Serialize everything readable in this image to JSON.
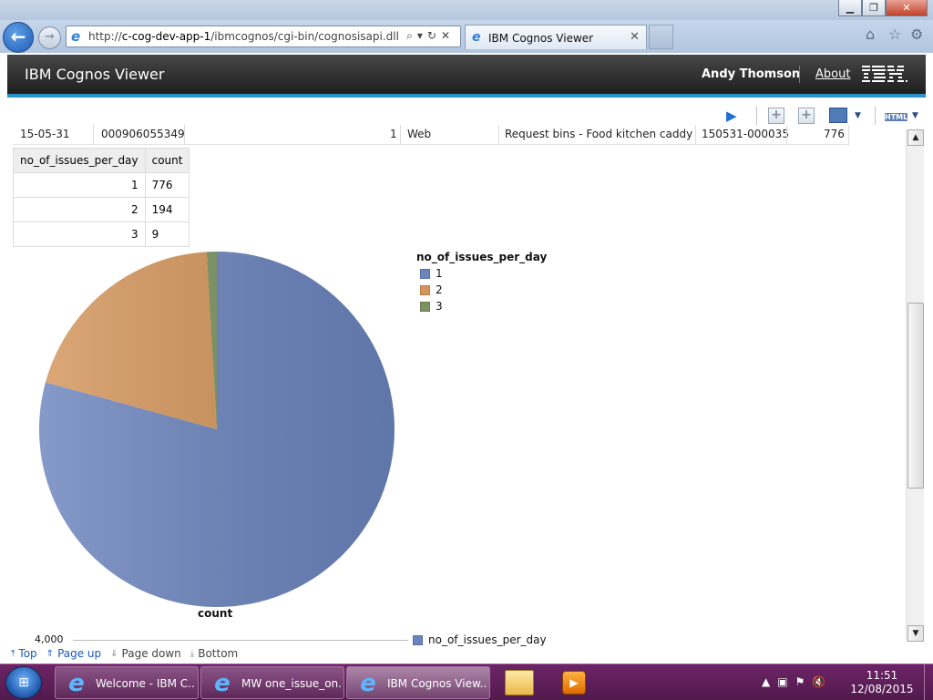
{
  "browser": {
    "url_prefix": "http://",
    "url_host": "c-cog-dev-app-1",
    "url_path": "/ibmcognos/cgi-bin/cognosisapi.dll",
    "tab_title": "IBM Cognos Viewer"
  },
  "header": {
    "app_title": "IBM Cognos Viewer",
    "user_name": "Andy Thomson",
    "about_link": "About",
    "logo": "IBM."
  },
  "list_row": {
    "date": "15-05-31",
    "id": "000906055349",
    "count": "1",
    "channel": "Web",
    "request": "Request bins - Food kitchen caddy",
    "case_ref": "150531-000035",
    "total": "776"
  },
  "crosstab": {
    "headers": [
      "no_of_issues_per_day",
      "count"
    ],
    "rows": [
      {
        "issues": "1",
        "count": "776"
      },
      {
        "issues": "2",
        "count": "194"
      },
      {
        "issues": "3",
        "count": "9"
      }
    ]
  },
  "chart_data": {
    "type": "pie",
    "categories": [
      "1",
      "2",
      "3"
    ],
    "values": [
      776,
      194,
      9
    ],
    "colors": [
      "#6b84bd",
      "#d4955a",
      "#7a9360"
    ],
    "label": "count",
    "legend_title": "no_of_issues_per_day",
    "legend_position": "right"
  },
  "chart2": {
    "tick_label": "4,000",
    "legend_label": "no_of_issues_per_day"
  },
  "pager": {
    "top": "Top",
    "page_up": "Page up",
    "page_down": "Page down",
    "bottom": "Bottom"
  },
  "taskbar": {
    "tasks": [
      {
        "label": "Welcome - IBM C..."
      },
      {
        "label": "MW one_issue_on..."
      },
      {
        "label": "IBM Cognos View..."
      }
    ],
    "time": "11:51",
    "date": "12/08/2015"
  },
  "icons": {
    "back": "back-arrow-icon",
    "forward": "forward-arrow-icon",
    "home": "home-icon",
    "favorites": "star-icon",
    "tools": "gear-icon",
    "run": "run-report-icon"
  }
}
